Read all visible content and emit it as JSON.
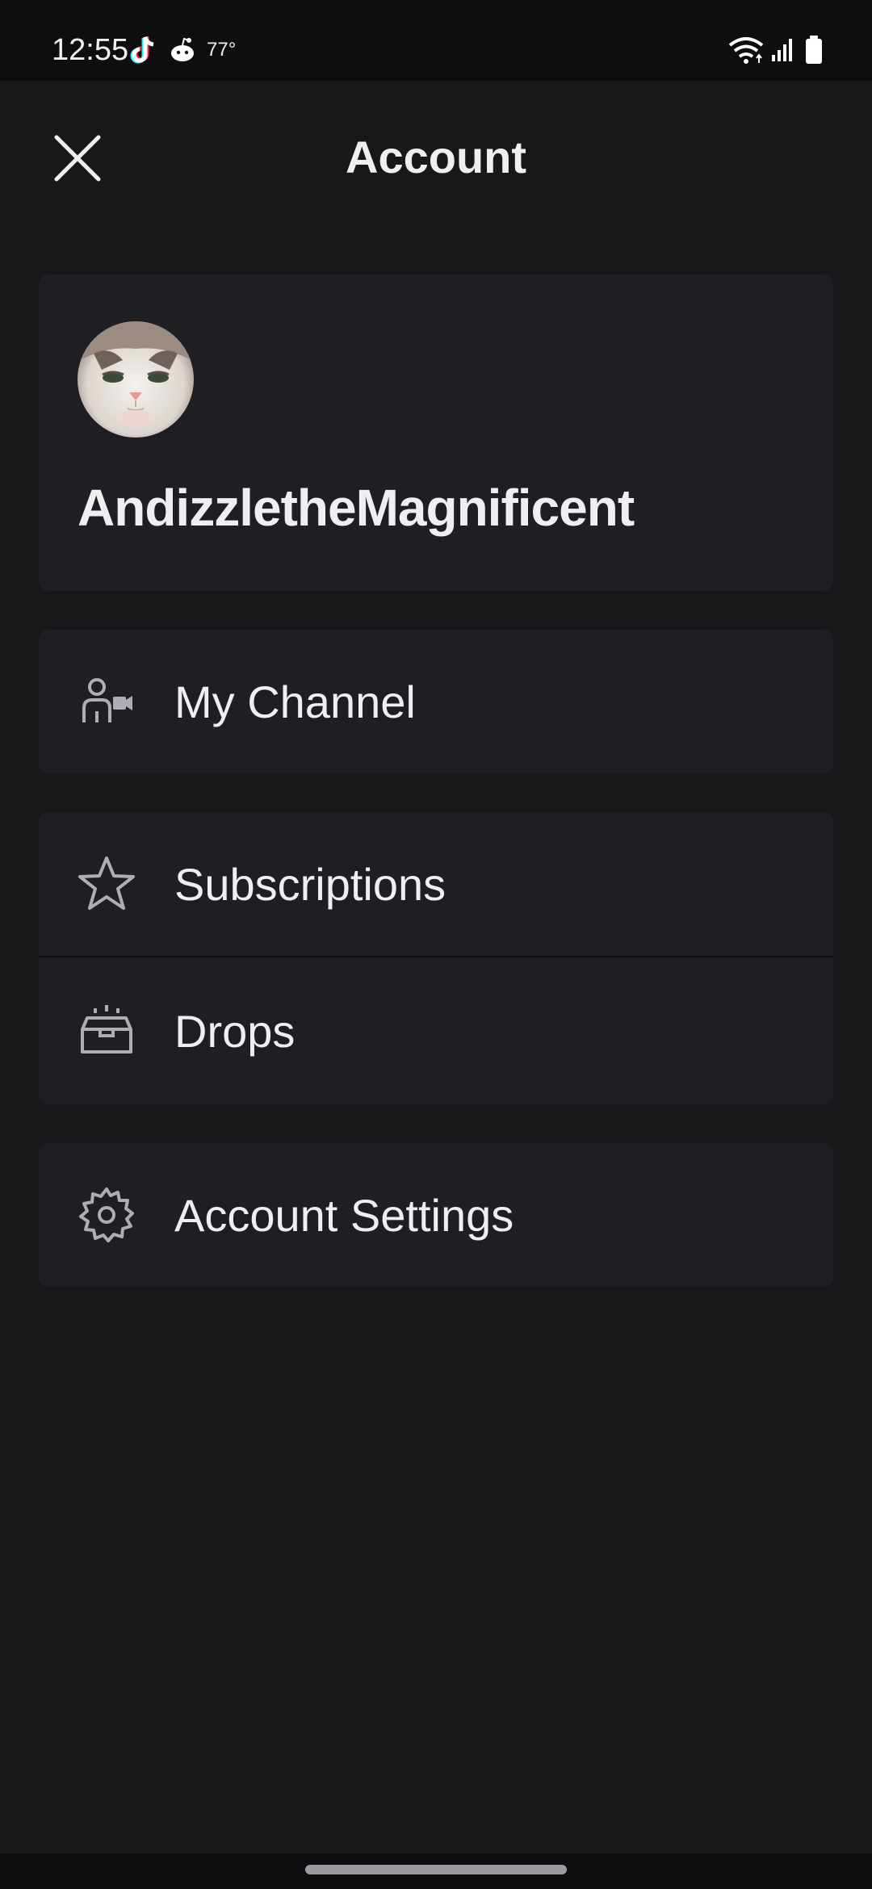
{
  "status_bar": {
    "time": "12:55",
    "temperature": "77°",
    "icons": [
      "tiktok-icon",
      "reddit-icon",
      "wifi-icon",
      "signal-icon",
      "battery-icon"
    ]
  },
  "header": {
    "title": "Account",
    "close_icon": "close-icon"
  },
  "profile": {
    "username": "AndizzletheMagnificent",
    "avatar": "cat-avatar"
  },
  "menu": {
    "my_channel": {
      "label": "My Channel",
      "icon": "channel-person-camera-icon"
    },
    "subscriptions": {
      "label": "Subscriptions",
      "icon": "star-icon"
    },
    "drops": {
      "label": "Drops",
      "icon": "drops-crate-icon"
    },
    "account_settings": {
      "label": "Account Settings",
      "icon": "gear-icon"
    }
  },
  "colors": {
    "background": "#18181b",
    "card": "#1f1f23",
    "status_bar": "#0e0e10",
    "text": "#efeff1",
    "icon": "#adadb8"
  }
}
